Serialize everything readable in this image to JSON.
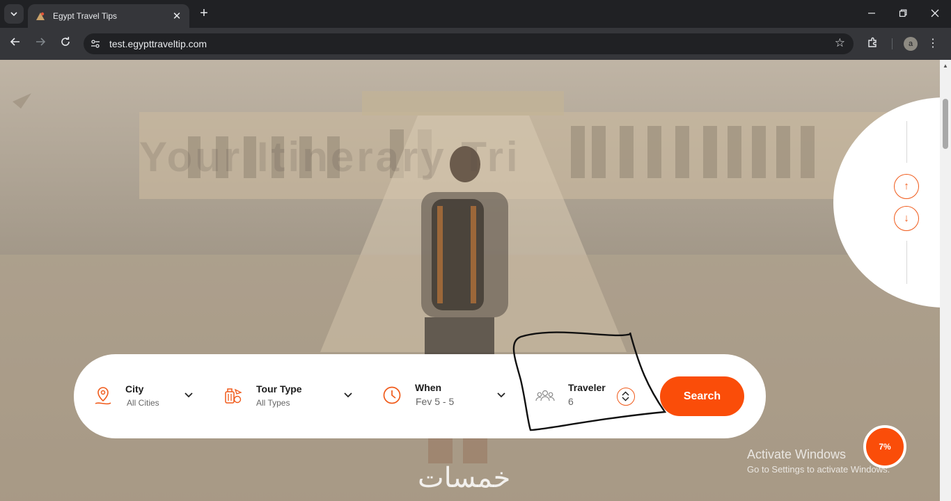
{
  "browser": {
    "tab_title": "Egypt Travel Tips",
    "url": "test.egypttraveltip.com",
    "avatar_letter": "a",
    "new_tab_glyph": "+",
    "tab_close_glyph": "✕"
  },
  "hero": {
    "background_watermark": "Your Itinerary Tri"
  },
  "pager": {
    "up": "↑",
    "down": "↓"
  },
  "search": {
    "city": {
      "label": "City",
      "value": "All Cities",
      "icon": "location-pin-icon"
    },
    "tour_type": {
      "label": "Tour Type",
      "value": "All Types",
      "icon": "luggage-icon"
    },
    "when": {
      "label": "When",
      "value": "Fev 5 - 5",
      "icon": "clock-icon"
    },
    "traveler": {
      "label": "Traveler",
      "value": "6",
      "icon": "people-icon"
    },
    "button": "Search"
  },
  "scroll_progress": "7%",
  "os_notice": {
    "title": "Activate Windows",
    "subtitle": "Go to Settings to activate Windows."
  },
  "watermark": "خمسات",
  "colors": {
    "accent": "#fa4d09",
    "chrome_dark": "#202124",
    "chrome_toolbar": "#35363a"
  }
}
